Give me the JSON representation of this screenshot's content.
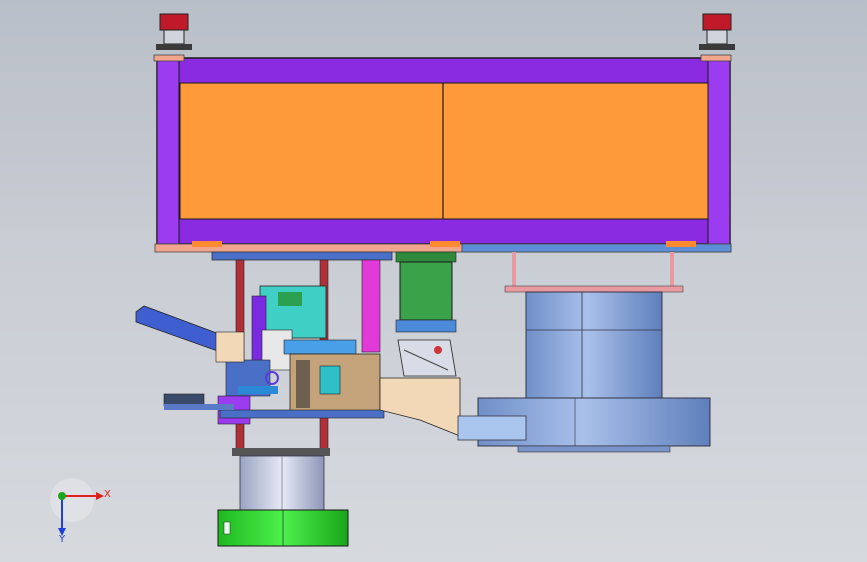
{
  "triad": {
    "x_label": "X",
    "y_label": "Y",
    "x_color": "#e0201a",
    "y_color": "#1f3fd6",
    "z_color": "#1aa51a"
  },
  "colors": {
    "frame": "#8a2be2",
    "panel": "#ff9a3a",
    "plate_salmon": "#f0a58c",
    "plate_blue": "#4a6fc7",
    "steel_blue": "#8aa6d6",
    "green_drum": "#2ee02e",
    "column_red": "#b0303a",
    "beige": "#f3d8b8"
  }
}
